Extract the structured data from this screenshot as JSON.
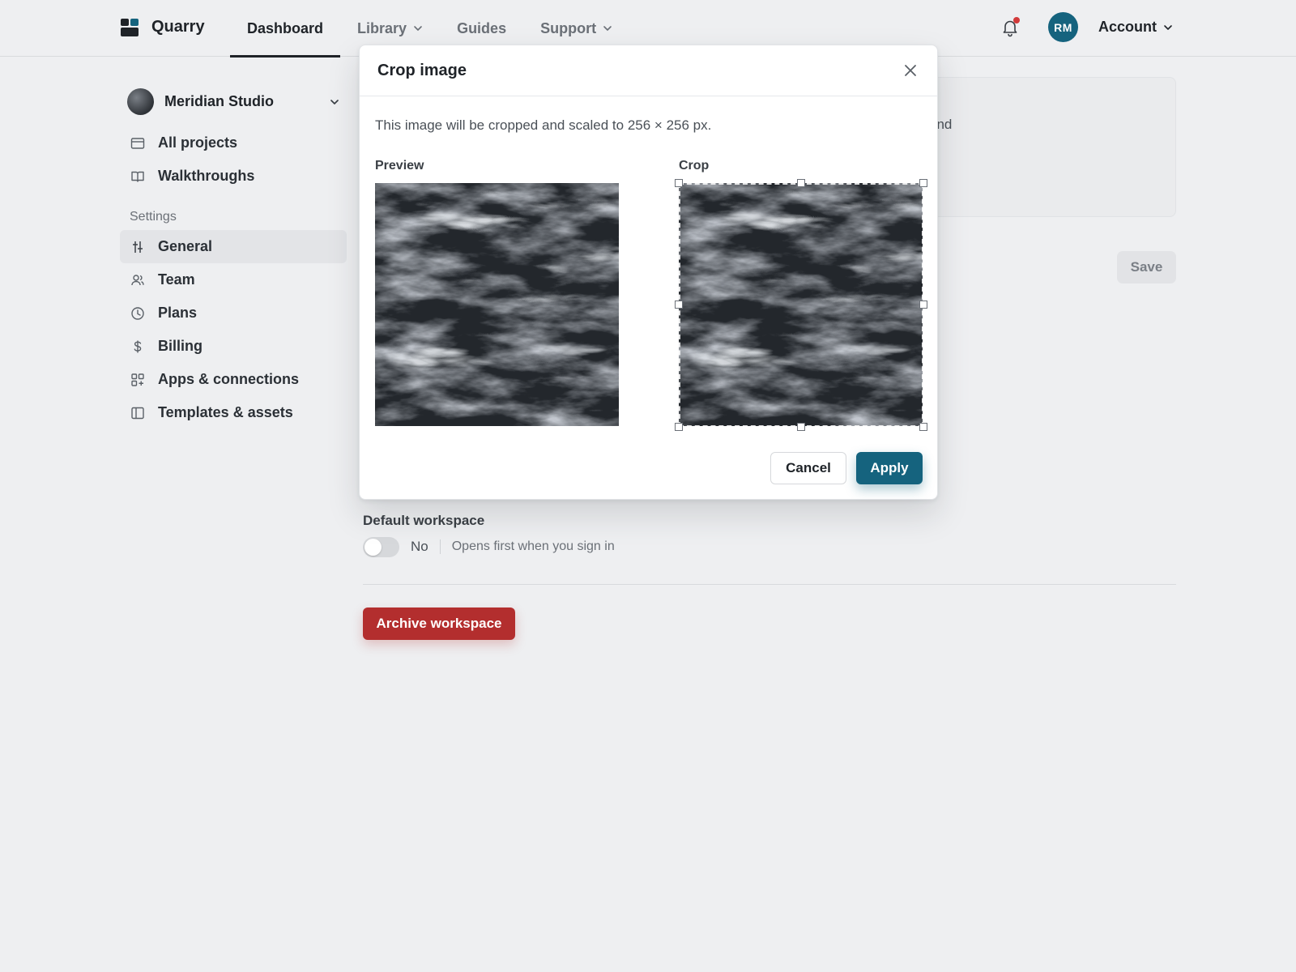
{
  "app": {
    "name": "Quarry"
  },
  "nav": {
    "items": [
      {
        "label": "Dashboard",
        "active": true,
        "has_dropdown": false
      },
      {
        "label": "Library",
        "active": false,
        "has_dropdown": true
      },
      {
        "label": "Guides",
        "active": false,
        "has_dropdown": false
      },
      {
        "label": "Support",
        "active": false,
        "has_dropdown": true
      }
    ],
    "user_initials": "RM",
    "account_label": "Account",
    "notification_dot": true
  },
  "sidebar": {
    "workspace_name": "Meridian Studio",
    "top_items": [
      {
        "label": "All projects",
        "icon": "window-icon"
      },
      {
        "label": "Walkthroughs",
        "icon": "book-icon"
      }
    ],
    "settings_heading": "Settings",
    "settings_items": [
      {
        "label": "General",
        "icon": "sliders-icon",
        "active": true
      },
      {
        "label": "Team",
        "icon": "users-icon",
        "active": false
      },
      {
        "label": "Plans",
        "icon": "clock-icon",
        "active": false
      },
      {
        "label": "Billing",
        "icon": "dollar-icon",
        "active": false
      },
      {
        "label": "Apps & connections",
        "icon": "apps-icon",
        "active": false
      },
      {
        "label": "Templates & assets",
        "icon": "panel-icon",
        "active": false
      }
    ]
  },
  "main": {
    "card_partial_text": "and",
    "save_label": "Save",
    "default_workspace": {
      "label": "Default workspace",
      "value": "No",
      "help": "Opens first when you sign in",
      "enabled": false
    },
    "archive_label": "Archive workspace"
  },
  "modal": {
    "title": "Crop image",
    "description": "This image will be cropped and scaled to 256 × 256 px.",
    "preview_label": "Preview",
    "crop_label": "Crop",
    "cancel_label": "Cancel",
    "apply_label": "Apply"
  },
  "colors": {
    "accent": "#15637e",
    "danger": "#b32e2e",
    "background": "#eeeff1",
    "notification": "#d23a3a"
  }
}
